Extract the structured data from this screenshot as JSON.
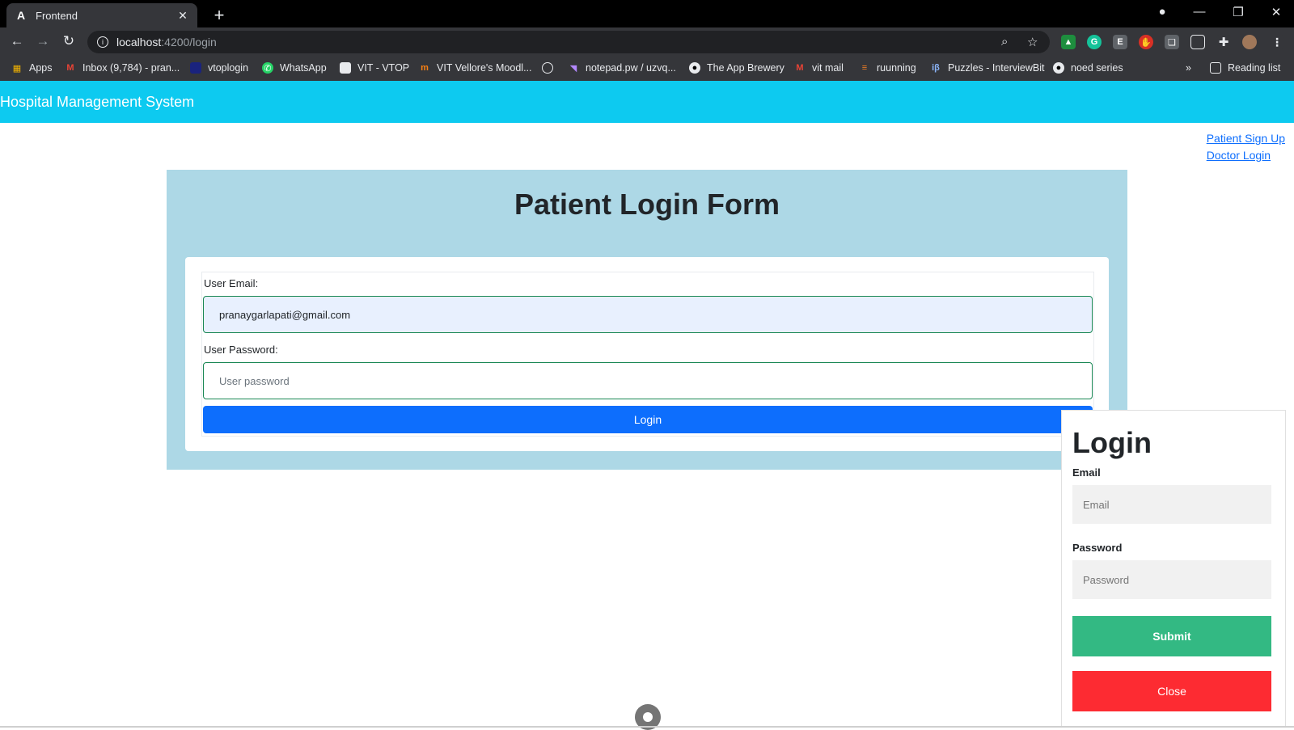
{
  "browser": {
    "tab": {
      "title": "Frontend",
      "favicon": "angular-icon",
      "close": "✕"
    },
    "new_tab": "+",
    "url": {
      "host": "localhost",
      "path": ":4200/login"
    },
    "window_controls": {
      "minimize": "—",
      "restore": "❐",
      "close": "✕"
    },
    "bookmarks": [
      {
        "label": "Apps",
        "icon": "apps-grid-icon"
      },
      {
        "label": "Inbox (9,784) - pran...",
        "icon": "gmail-icon"
      },
      {
        "label": "vtoplogin",
        "icon": "globe-icon"
      },
      {
        "label": "WhatsApp",
        "icon": "whatsapp-icon"
      },
      {
        "label": "VIT - VTOP",
        "icon": "page-icon"
      },
      {
        "label": "VIT Vellore's Moodl...",
        "icon": "moodle-icon"
      },
      {
        "label": "",
        "icon": "globe-icon"
      },
      {
        "label": "notepad.pw / uzvq...",
        "icon": "notepad-icon"
      },
      {
        "label": "The App Brewery",
        "icon": "brewery-icon"
      },
      {
        "label": "vit mail",
        "icon": "gmail-icon"
      },
      {
        "label": "ruunning",
        "icon": "stack-icon"
      },
      {
        "label": "Puzzles - InterviewBit",
        "icon": "interviewbit-icon"
      },
      {
        "label": "noed series",
        "icon": "github-icon"
      }
    ],
    "bookmarks_overflow": "»",
    "reading_list": "Reading list"
  },
  "app": {
    "brand": "Hospital Management System",
    "links": {
      "signup": "Patient Sign Up",
      "doctor": "Doctor Login"
    },
    "form": {
      "title": "Patient Login Form",
      "email_label": "User Email:",
      "email_value": "pranaygarlapati@gmail.com",
      "password_label": "User Password:",
      "password_placeholder": "User password",
      "login_button": "Login"
    },
    "popup": {
      "title": "Login",
      "email_label": "Email",
      "email_placeholder": "Email",
      "password_label": "Password",
      "password_placeholder": "Password",
      "submit": "Submit",
      "close": "Close"
    }
  },
  "colors": {
    "navbar": "#0dcaf0",
    "card": "#add8e6",
    "primary": "#0d6efd",
    "submit": "#33b983",
    "close": "#fd2b32",
    "field_border": "#198754"
  }
}
